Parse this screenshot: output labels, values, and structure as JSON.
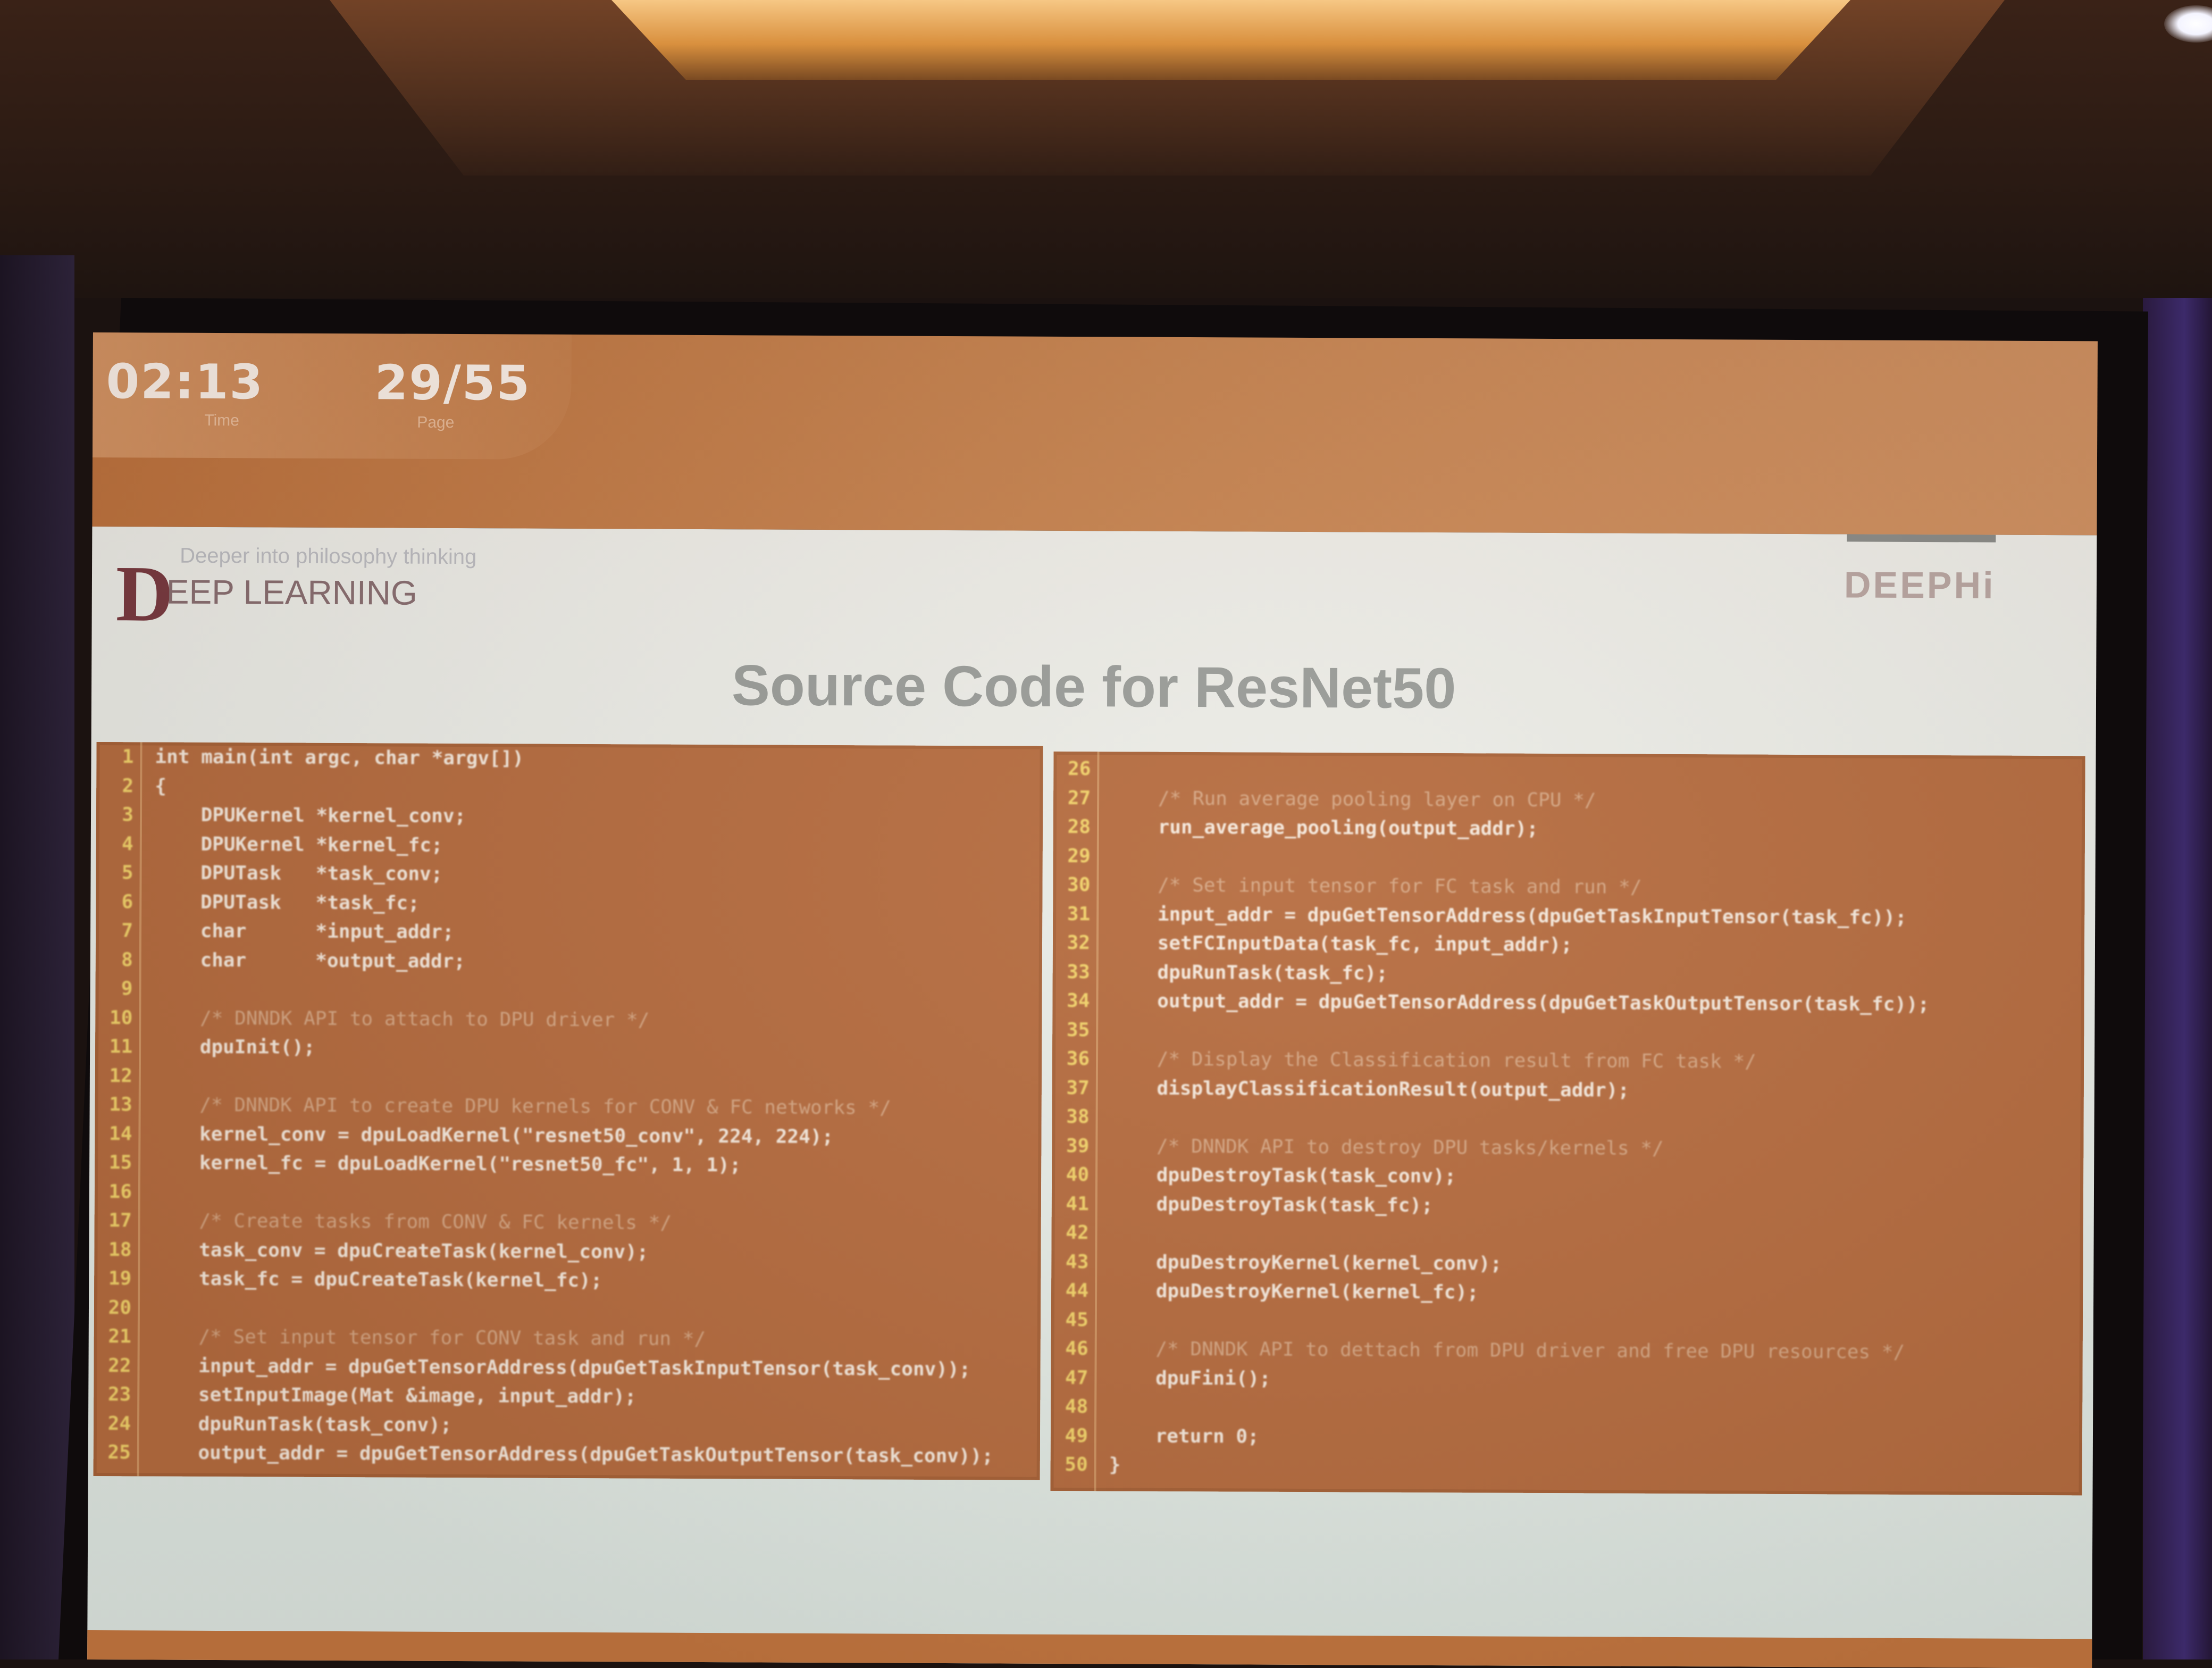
{
  "slide": {
    "time_value": "02:13",
    "time_label": "Time",
    "page_value": "29/55",
    "page_label": "Page",
    "logo_letter": "D",
    "logo_word": "EEP LEARNING",
    "logo_tagline": "Deeper into philosophy thinking",
    "brand": "DEEPHi",
    "title": "Source Code for ResNet50"
  },
  "code_left": [
    {
      "n": "1",
      "text": "int main(int argc, char *argv[])"
    },
    {
      "n": "2",
      "text": "{"
    },
    {
      "n": "3",
      "text": "    DPUKernel *kernel_conv;"
    },
    {
      "n": "4",
      "text": "    DPUKernel *kernel_fc;"
    },
    {
      "n": "5",
      "text": "    DPUTask   *task_conv;"
    },
    {
      "n": "6",
      "text": "    DPUTask   *task_fc;"
    },
    {
      "n": "7",
      "text": "    char      *input_addr;"
    },
    {
      "n": "8",
      "text": "    char      *output_addr;"
    },
    {
      "n": "9",
      "text": ""
    },
    {
      "n": "10",
      "text": "    /* DNNDK API to attach to DPU driver */",
      "kind": "comment"
    },
    {
      "n": "11",
      "text": "    dpuInit();"
    },
    {
      "n": "12",
      "text": ""
    },
    {
      "n": "13",
      "text": "    /* DNNDK API to create DPU kernels for CONV & FC networks */",
      "kind": "comment"
    },
    {
      "n": "14",
      "text": "    kernel_conv = dpuLoadKernel(\"resnet50_conv\", 224, 224);"
    },
    {
      "n": "15",
      "text": "    kernel_fc = dpuLoadKernel(\"resnet50_fc\", 1, 1);"
    },
    {
      "n": "16",
      "text": ""
    },
    {
      "n": "17",
      "text": "    /* Create tasks from CONV & FC kernels */",
      "kind": "comment"
    },
    {
      "n": "18",
      "text": "    task_conv = dpuCreateTask(kernel_conv);"
    },
    {
      "n": "19",
      "text": "    task_fc = dpuCreateTask(kernel_fc);"
    },
    {
      "n": "20",
      "text": ""
    },
    {
      "n": "21",
      "text": "    /* Set input tensor for CONV task and run */",
      "kind": "comment"
    },
    {
      "n": "22",
      "text": "    input_addr = dpuGetTensorAddress(dpuGetTaskInputTensor(task_conv));"
    },
    {
      "n": "23",
      "text": "    setInputImage(Mat &image, input_addr);"
    },
    {
      "n": "24",
      "text": "    dpuRunTask(task_conv);"
    },
    {
      "n": "25",
      "text": "    output_addr = dpuGetTensorAddress(dpuGetTaskOutputTensor(task_conv));"
    }
  ],
  "code_right": [
    {
      "n": "26",
      "text": ""
    },
    {
      "n": "27",
      "text": "    /* Run average pooling layer on CPU */",
      "kind": "comment"
    },
    {
      "n": "28",
      "text": "    run_average_pooling(output_addr);"
    },
    {
      "n": "29",
      "text": ""
    },
    {
      "n": "30",
      "text": "    /* Set input tensor for FC task and run */",
      "kind": "comment"
    },
    {
      "n": "31",
      "text": "    input_addr = dpuGetTensorAddress(dpuGetTaskInputTensor(task_fc));"
    },
    {
      "n": "32",
      "text": "    setFCInputData(task_fc, input_addr);"
    },
    {
      "n": "33",
      "text": "    dpuRunTask(task_fc);"
    },
    {
      "n": "34",
      "text": "    output_addr = dpuGetTensorAddress(dpuGetTaskOutputTensor(task_fc));"
    },
    {
      "n": "35",
      "text": ""
    },
    {
      "n": "36",
      "text": "    /* Display the Classification result from FC task */",
      "kind": "comment"
    },
    {
      "n": "37",
      "text": "    displayClassificationResult(output_addr);"
    },
    {
      "n": "38",
      "text": ""
    },
    {
      "n": "39",
      "text": "    /* DNNDK API to destroy DPU tasks/kernels */",
      "kind": "comment"
    },
    {
      "n": "40",
      "text": "    dpuDestroyTask(task_conv);"
    },
    {
      "n": "41",
      "text": "    dpuDestroyTask(task_fc);"
    },
    {
      "n": "42",
      "text": ""
    },
    {
      "n": "43",
      "text": "    dpuDestroyKernel(kernel_conv);"
    },
    {
      "n": "44",
      "text": "    dpuDestroyKernel(kernel_fc);"
    },
    {
      "n": "45",
      "text": ""
    },
    {
      "n": "46",
      "text": "    /* DNNDK API to dettach from DPU driver and free DPU resources */",
      "kind": "comment"
    },
    {
      "n": "47",
      "text": "    dpuFini();"
    },
    {
      "n": "48",
      "text": ""
    },
    {
      "n": "49",
      "text": "    return 0;"
    },
    {
      "n": "50",
      "text": "}"
    }
  ]
}
